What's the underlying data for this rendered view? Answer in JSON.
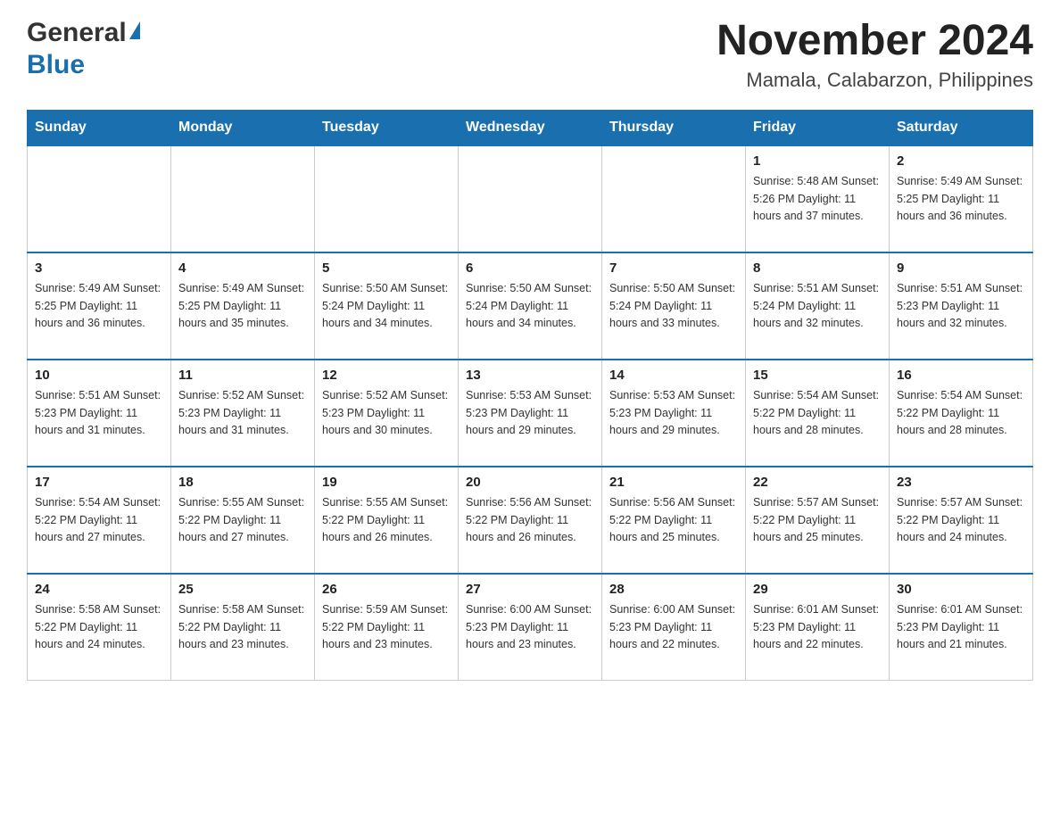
{
  "header": {
    "logo_general": "General",
    "logo_blue": "Blue",
    "month_title": "November 2024",
    "location": "Mamala, Calabarzon, Philippines"
  },
  "days_of_week": [
    "Sunday",
    "Monday",
    "Tuesday",
    "Wednesday",
    "Thursday",
    "Friday",
    "Saturday"
  ],
  "weeks": [
    [
      {
        "day": "",
        "info": ""
      },
      {
        "day": "",
        "info": ""
      },
      {
        "day": "",
        "info": ""
      },
      {
        "day": "",
        "info": ""
      },
      {
        "day": "",
        "info": ""
      },
      {
        "day": "1",
        "info": "Sunrise: 5:48 AM\nSunset: 5:26 PM\nDaylight: 11 hours and 37 minutes."
      },
      {
        "day": "2",
        "info": "Sunrise: 5:49 AM\nSunset: 5:25 PM\nDaylight: 11 hours and 36 minutes."
      }
    ],
    [
      {
        "day": "3",
        "info": "Sunrise: 5:49 AM\nSunset: 5:25 PM\nDaylight: 11 hours and 36 minutes."
      },
      {
        "day": "4",
        "info": "Sunrise: 5:49 AM\nSunset: 5:25 PM\nDaylight: 11 hours and 35 minutes."
      },
      {
        "day": "5",
        "info": "Sunrise: 5:50 AM\nSunset: 5:24 PM\nDaylight: 11 hours and 34 minutes."
      },
      {
        "day": "6",
        "info": "Sunrise: 5:50 AM\nSunset: 5:24 PM\nDaylight: 11 hours and 34 minutes."
      },
      {
        "day": "7",
        "info": "Sunrise: 5:50 AM\nSunset: 5:24 PM\nDaylight: 11 hours and 33 minutes."
      },
      {
        "day": "8",
        "info": "Sunrise: 5:51 AM\nSunset: 5:24 PM\nDaylight: 11 hours and 32 minutes."
      },
      {
        "day": "9",
        "info": "Sunrise: 5:51 AM\nSunset: 5:23 PM\nDaylight: 11 hours and 32 minutes."
      }
    ],
    [
      {
        "day": "10",
        "info": "Sunrise: 5:51 AM\nSunset: 5:23 PM\nDaylight: 11 hours and 31 minutes."
      },
      {
        "day": "11",
        "info": "Sunrise: 5:52 AM\nSunset: 5:23 PM\nDaylight: 11 hours and 31 minutes."
      },
      {
        "day": "12",
        "info": "Sunrise: 5:52 AM\nSunset: 5:23 PM\nDaylight: 11 hours and 30 minutes."
      },
      {
        "day": "13",
        "info": "Sunrise: 5:53 AM\nSunset: 5:23 PM\nDaylight: 11 hours and 29 minutes."
      },
      {
        "day": "14",
        "info": "Sunrise: 5:53 AM\nSunset: 5:23 PM\nDaylight: 11 hours and 29 minutes."
      },
      {
        "day": "15",
        "info": "Sunrise: 5:54 AM\nSunset: 5:22 PM\nDaylight: 11 hours and 28 minutes."
      },
      {
        "day": "16",
        "info": "Sunrise: 5:54 AM\nSunset: 5:22 PM\nDaylight: 11 hours and 28 minutes."
      }
    ],
    [
      {
        "day": "17",
        "info": "Sunrise: 5:54 AM\nSunset: 5:22 PM\nDaylight: 11 hours and 27 minutes."
      },
      {
        "day": "18",
        "info": "Sunrise: 5:55 AM\nSunset: 5:22 PM\nDaylight: 11 hours and 27 minutes."
      },
      {
        "day": "19",
        "info": "Sunrise: 5:55 AM\nSunset: 5:22 PM\nDaylight: 11 hours and 26 minutes."
      },
      {
        "day": "20",
        "info": "Sunrise: 5:56 AM\nSunset: 5:22 PM\nDaylight: 11 hours and 26 minutes."
      },
      {
        "day": "21",
        "info": "Sunrise: 5:56 AM\nSunset: 5:22 PM\nDaylight: 11 hours and 25 minutes."
      },
      {
        "day": "22",
        "info": "Sunrise: 5:57 AM\nSunset: 5:22 PM\nDaylight: 11 hours and 25 minutes."
      },
      {
        "day": "23",
        "info": "Sunrise: 5:57 AM\nSunset: 5:22 PM\nDaylight: 11 hours and 24 minutes."
      }
    ],
    [
      {
        "day": "24",
        "info": "Sunrise: 5:58 AM\nSunset: 5:22 PM\nDaylight: 11 hours and 24 minutes."
      },
      {
        "day": "25",
        "info": "Sunrise: 5:58 AM\nSunset: 5:22 PM\nDaylight: 11 hours and 23 minutes."
      },
      {
        "day": "26",
        "info": "Sunrise: 5:59 AM\nSunset: 5:22 PM\nDaylight: 11 hours and 23 minutes."
      },
      {
        "day": "27",
        "info": "Sunrise: 6:00 AM\nSunset: 5:23 PM\nDaylight: 11 hours and 23 minutes."
      },
      {
        "day": "28",
        "info": "Sunrise: 6:00 AM\nSunset: 5:23 PM\nDaylight: 11 hours and 22 minutes."
      },
      {
        "day": "29",
        "info": "Sunrise: 6:01 AM\nSunset: 5:23 PM\nDaylight: 11 hours and 22 minutes."
      },
      {
        "day": "30",
        "info": "Sunrise: 6:01 AM\nSunset: 5:23 PM\nDaylight: 11 hours and 21 minutes."
      }
    ]
  ]
}
